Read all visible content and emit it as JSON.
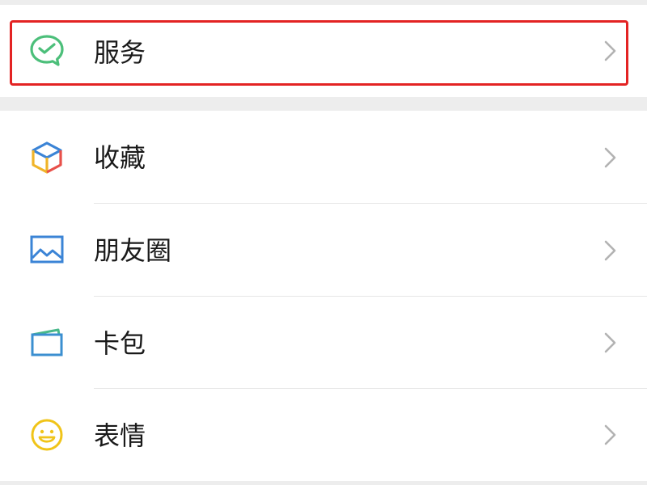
{
  "menu": {
    "top_group": [
      {
        "id": "services",
        "label": "服务",
        "icon": "services-icon"
      }
    ],
    "main_group": [
      {
        "id": "favorites",
        "label": "收藏",
        "icon": "favorites-cube-icon"
      },
      {
        "id": "moments",
        "label": "朋友圈",
        "icon": "moments-photo-icon"
      },
      {
        "id": "cards",
        "label": "卡包",
        "icon": "card-wallet-icon"
      },
      {
        "id": "stickers",
        "label": "表情",
        "icon": "smiley-face-icon"
      }
    ]
  },
  "colors": {
    "background": "#ededed",
    "row_background": "#ffffff",
    "highlight": "#e32323",
    "services_icon": "#4cbf7a",
    "moments_icon": "#3b84d6",
    "card_icon": "#3b8fd0",
    "smiley_icon": "#f0c419",
    "chevron": "#b2b2b2"
  }
}
